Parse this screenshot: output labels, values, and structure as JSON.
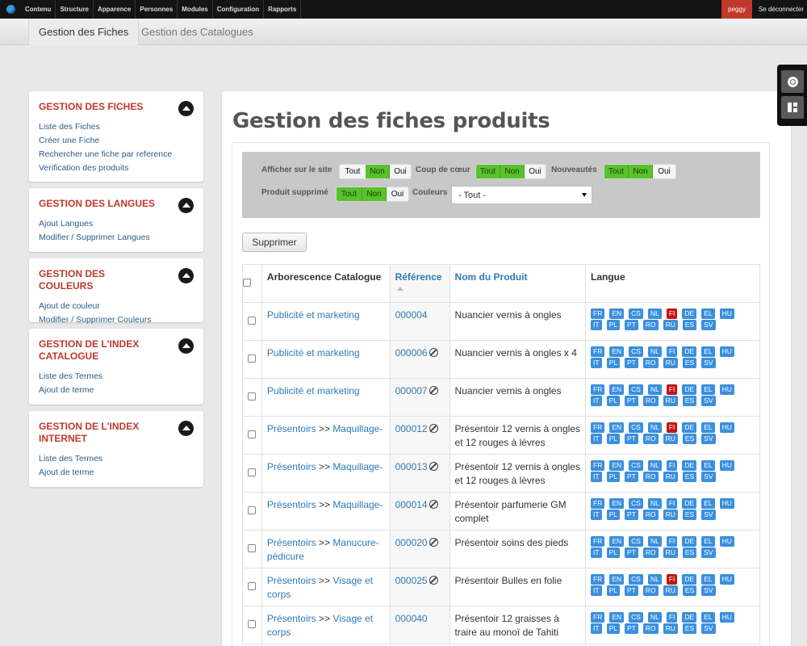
{
  "admin_bar": {
    "menu": [
      "Contenu",
      "Structure",
      "Apparence",
      "Personnes",
      "Modules",
      "Configuration",
      "Rapports"
    ],
    "user": "peggy",
    "logout": "Se déconnecter"
  },
  "tabs": [
    "Gestion des Fiches",
    "Gestion des Catalogues"
  ],
  "sidebar": [
    {
      "title": "GESTION DES FICHES",
      "links": [
        "Liste des Fiches",
        "Créer une Fiche",
        "Rechercher une fiche par reference",
        "Verification des produits"
      ]
    },
    {
      "title": "GESTION DES LANGUES",
      "links": [
        "Ajout Langues",
        "Modifier / Supprimer Langues"
      ]
    },
    {
      "title": "GESTION DES COULEURS",
      "links": [
        "Ajout de couleur",
        "Modifier / Supprimer Couleurs"
      ]
    },
    {
      "title": "GESTION DE L'INDEX CATALOGUE",
      "links": [
        "Liste des Termes",
        "Ajout de terme"
      ]
    },
    {
      "title": "GESTION DE L'INDEX INTERNET",
      "links": [
        "Liste des Termes",
        "Ajout de terme"
      ]
    }
  ],
  "main": {
    "title": "Gestion des fiches produits",
    "filters": {
      "afficher": {
        "label": "Afficher sur le site",
        "options": [
          "Tout",
          "Non",
          "Oui"
        ]
      },
      "coup": {
        "label": "Coup de cœur",
        "options": [
          "Tout",
          "Non",
          "Oui"
        ]
      },
      "nouveautes": {
        "label": "Nouveautés",
        "options": [
          "Tout",
          "Non",
          "Oui"
        ]
      },
      "supprime": {
        "label": "Produit supprimé",
        "options": [
          "Tout",
          "Non",
          "Oui"
        ]
      },
      "couleurs": {
        "label": "Couleurs",
        "value": "- Tout -"
      }
    },
    "delete_label": "Supprimer",
    "columns": [
      "Arborescence Catalogue",
      "Référence",
      "Nom du Produit",
      "Langue"
    ],
    "langs": [
      "FR",
      "EN",
      "CS",
      "NL",
      "FI",
      "DE",
      "EL",
      "HU",
      "IT",
      "PL",
      "PT",
      "RO",
      "RU",
      "ES",
      "SV"
    ],
    "rows": [
      {
        "cat_a": "Publicité et marketing",
        "cat_b": "",
        "ref": "000004",
        "ban": false,
        "name": "Nuancier vernis à ongles",
        "fi_red": true
      },
      {
        "cat_a": "Publicité et marketing",
        "cat_b": "",
        "ref": "000006",
        "ban": true,
        "name": "Nuancier vernis à ongles x 4",
        "fi_red": false
      },
      {
        "cat_a": "Publicité et marketing",
        "cat_b": "",
        "ref": "000007",
        "ban": true,
        "name": "Nuancier vernis à ongles",
        "fi_red": true
      },
      {
        "cat_a": "Présentoirs",
        "cat_b": "Maquillage-",
        "ref": "000012",
        "ban": true,
        "name": "Présentoir 12 vernis à ongles et 12 rouges à lèvres",
        "fi_red": true
      },
      {
        "cat_a": "Présentoirs",
        "cat_b": "Maquillage-",
        "ref": "000013",
        "ban": true,
        "name": "Présentoir 12 vernis à ongles et 12 rouges à lèvres",
        "fi_red": false
      },
      {
        "cat_a": "Présentoirs",
        "cat_b": "Maquillage-",
        "ref": "000014",
        "ban": true,
        "name": "Présentoir parfumerie GM complet",
        "fi_red": false
      },
      {
        "cat_a": "Présentoirs",
        "cat_b": "Manucure-pédicure",
        "ref": "000020",
        "ban": true,
        "name": "Présentoir soins des pieds",
        "fi_red": false
      },
      {
        "cat_a": "Présentoirs",
        "cat_b": "Visage et corps",
        "ref": "000025",
        "ban": true,
        "name": "Présentoir Bulles en folie",
        "fi_red": true
      },
      {
        "cat_a": "Présentoirs",
        "cat_b": "Visage et corps",
        "ref": "000040",
        "ban": false,
        "name": "Présentoir 12 graisses à traire au monoï de Tahiti",
        "fi_red": false
      }
    ]
  },
  "colors": {
    "accent_red": "#c0392b",
    "lang_blue": "#3a8fde",
    "lang_red": "#c41414",
    "toggle_green": "#58c22c"
  }
}
